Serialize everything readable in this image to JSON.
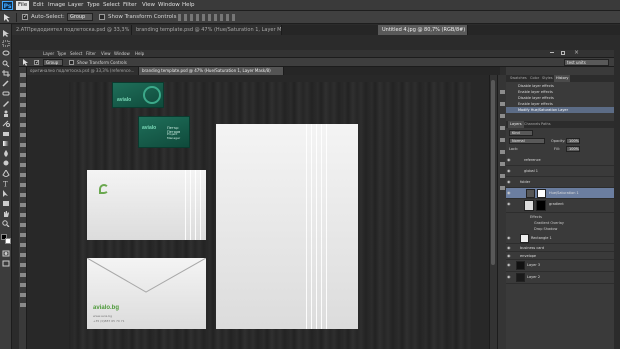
{
  "app": {
    "logo": "Ps"
  },
  "menu": [
    "File",
    "Edit",
    "Image",
    "Layer",
    "Type",
    "Select",
    "Filter",
    "View",
    "Window",
    "Help"
  ],
  "options": {
    "auto_select_label": "Auto-Select:",
    "auto_select_value": "Group",
    "transform_label": "Show Transform Controls"
  },
  "tabs": [
    "2.ATПредодиятел подлетоска.psd @ 33,3% (reference, RGB/8)",
    "branding template.psd @ 47% (Hue/Saturation 1, Layer Mask/8)",
    "Untitled 4.jpg @ 80,7% (RGB/8#)"
  ],
  "inner": {
    "menu": [
      "Layer",
      "Type",
      "Select",
      "Filter",
      "View",
      "Window",
      "Help"
    ],
    "auto_select_value": "Group",
    "transform_label": "Show Transform Controls",
    "workspace": "test units",
    "tabs": [
      "оригинално подлетоска.psd @ 33,3% (reference...",
      "branding template.psd @ 47% (Hue/Saturation 1, Layer Mask/8)"
    ]
  },
  "mockup": {
    "card_logo": "avialo",
    "card_person": "Петър Петров",
    "card_role": "Project Manager",
    "brand": "avialo.bg",
    "envelope_url": "www.avia.bg",
    "envelope_phone": "+35 (0)887 65 70 71"
  },
  "panels": {
    "history_tabs": [
      "Swatches",
      "Color",
      "Styles",
      "History"
    ],
    "history_items": [
      "Disable layer effects",
      "Enable layer effects",
      "Disable layer effects",
      "Enable layer effects",
      "Modify Hue/Saturation Layer"
    ],
    "layers_tabs": [
      "Layers",
      "Channels",
      "Paths"
    ],
    "kind_label": "Kind",
    "blend_mode": "Normal",
    "opacity_label": "Opacity:",
    "opacity_value": "100%",
    "lock_label": "Lock:",
    "fill_label": "Fill:",
    "fill_value": "100%",
    "layers": [
      "reference",
      "global 1",
      "folder",
      "Hue/Saturation 1",
      "gradient",
      "Effects",
      "Gradient Overlay",
      "Drop Shadow",
      "Rectangle 1",
      "business card",
      "envelope",
      "Layer 3",
      "Layer 2"
    ]
  },
  "colors": {
    "accent_green": "#4e9a3a",
    "card_teal": "#1f6f5a",
    "selection_blue": "#6b7ea0"
  }
}
